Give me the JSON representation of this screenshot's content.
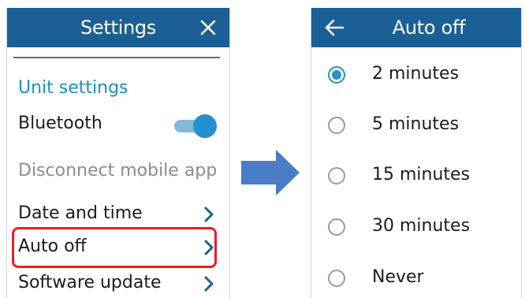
{
  "settings_screen": {
    "title": "Settings",
    "close_icon": "close-icon",
    "section_header": "Unit settings",
    "items": [
      {
        "label": "Bluetooth",
        "control": "toggle",
        "state": "on"
      },
      {
        "label": "Disconnect mobile app",
        "control": "none",
        "enabled": false
      },
      {
        "label": "Date and time",
        "control": "chevron"
      },
      {
        "label": "Auto off",
        "control": "chevron",
        "highlighted": true
      },
      {
        "label": "Software update",
        "control": "chevron"
      }
    ]
  },
  "flow_arrow": "arrow-right",
  "auto_off_screen": {
    "title": "Auto off",
    "back_icon": "back-arrow-icon",
    "options": [
      {
        "label": "2 minutes",
        "selected": true
      },
      {
        "label": "5 minutes",
        "selected": false
      },
      {
        "label": "15 minutes",
        "selected": false
      },
      {
        "label": "30 minutes",
        "selected": false
      },
      {
        "label": "Never",
        "selected": false
      }
    ]
  },
  "colors": {
    "header": "#1a5f95",
    "accent": "#2390cf",
    "section_header": "#1a8fc1",
    "highlight": "#e8202a",
    "arrow": "#4a7cc7",
    "disabled_text": "#8c8c8c"
  }
}
